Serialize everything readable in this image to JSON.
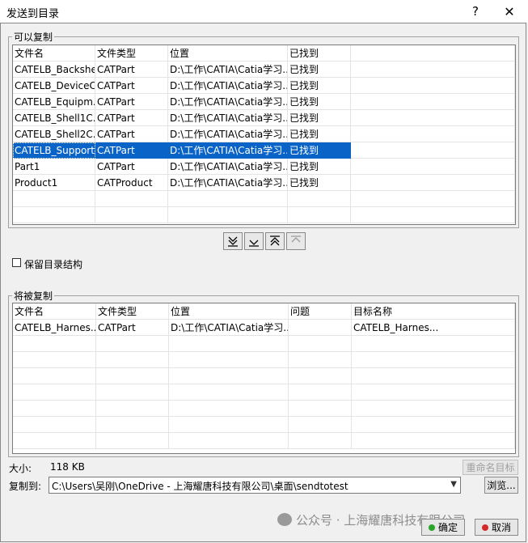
{
  "window": {
    "title": "发送到目录",
    "help": "?",
    "close": "✕"
  },
  "copyable": {
    "label": "可以复制",
    "columns": [
      "文件名",
      "文件类型",
      "位置",
      "已找到"
    ],
    "rows": [
      [
        "CATELB_Backshell",
        "CATPart",
        "D:\\工作\\CATIA\\Catia学习...",
        "已找到"
      ],
      [
        "CATELB_DeviceC...",
        "CATPart",
        "D:\\工作\\CATIA\\Catia学习...",
        "已找到"
      ],
      [
        "CATELB_Equipm...",
        "CATPart",
        "D:\\工作\\CATIA\\Catia学习...",
        "已找到"
      ],
      [
        "CATELB_Shell1C...",
        "CATPart",
        "D:\\工作\\CATIA\\Catia学习...",
        "已找到"
      ],
      [
        "CATELB_Shell2C...",
        "CATPart",
        "D:\\工作\\CATIA\\Catia学习...",
        "已找到"
      ],
      [
        "CATELB_Support",
        "CATPart",
        "D:\\工作\\CATIA\\Catia学习...",
        "已找到"
      ],
      [
        "Part1",
        "CATPart",
        "D:\\工作\\CATIA\\Catia学习...",
        "已找到"
      ],
      [
        "Product1",
        "CATProduct",
        "D:\\工作\\CATIA\\Catia学习...",
        "已找到"
      ]
    ],
    "selected_row": 5
  },
  "keep_structure": {
    "label": "保留目录结构",
    "checked": false
  },
  "to_copy": {
    "label": "将被复制",
    "columns": [
      "文件名",
      "文件类型",
      "位置",
      "问题",
      "目标名称"
    ],
    "rows": [
      [
        "CATELB_Harnes...",
        "CATPart",
        "D:\\工作\\CATIA\\Catia学习...",
        "",
        "CATELB_Harnes..."
      ]
    ]
  },
  "size": {
    "label": "大小:",
    "value": "118 KB"
  },
  "rename_target": "重命名目标",
  "copy_to": {
    "label": "复制到:",
    "value": "C:\\Users\\吴刚\\OneDrive - 上海耀唐科技有限公司\\桌面\\sendtotest"
  },
  "browse": "浏览...",
  "ok": "确定",
  "cancel": "取消",
  "watermark": "公众号 · 上海耀唐科技有限公司",
  "colors": {
    "selection": "#0a64c8",
    "ok_dot": "#2aa52a",
    "cancel_dot": "#d42a2a"
  }
}
